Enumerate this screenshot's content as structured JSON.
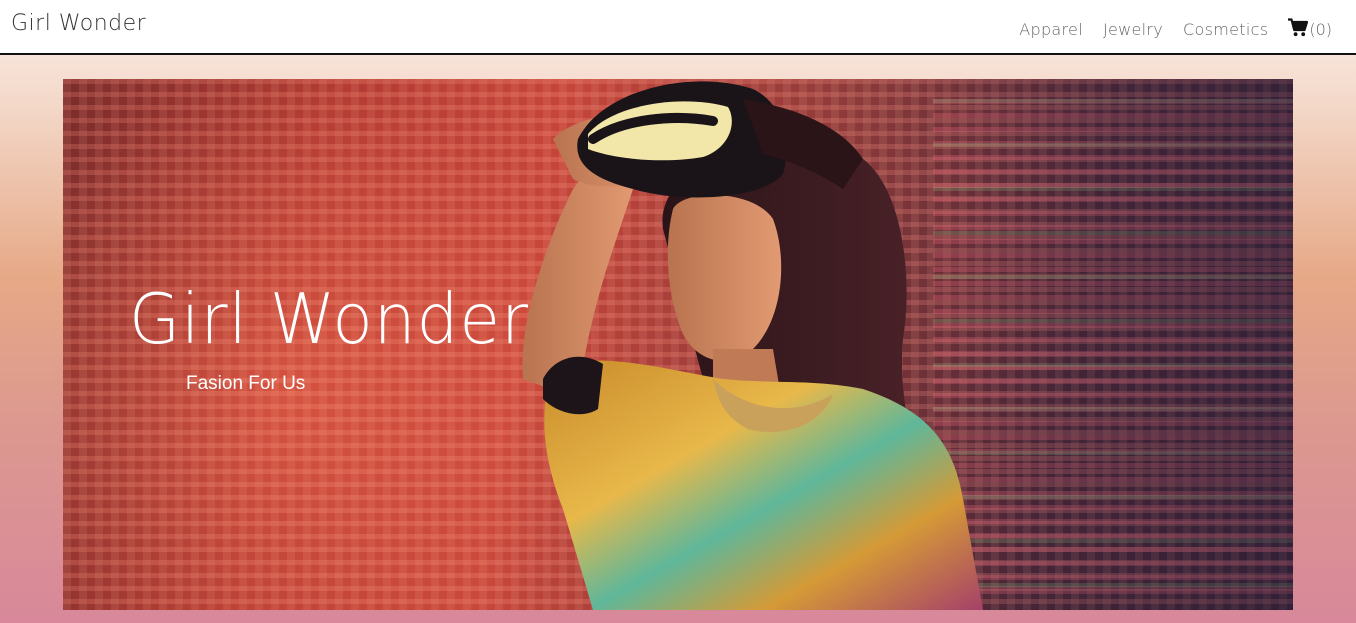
{
  "navbar": {
    "brand": "Girl Wonder",
    "links": [
      "Apparel",
      "Jewelry",
      "Cosmetics"
    ],
    "cart_icon": "shopping-cart-icon",
    "cart_count": "(0)"
  },
  "hero": {
    "title": "Girl Wonder",
    "subtitle": "Fasion For Us",
    "image": "woman-with-vr-headset-photo"
  },
  "colors": {
    "navbar_bg": "#ffffff",
    "navbar_border": "#111111",
    "nav_text": "#666666",
    "hero_text": "#ffffff",
    "page_gradient_top": "#fbf1ea",
    "page_gradient_bottom": "#d8889a"
  }
}
